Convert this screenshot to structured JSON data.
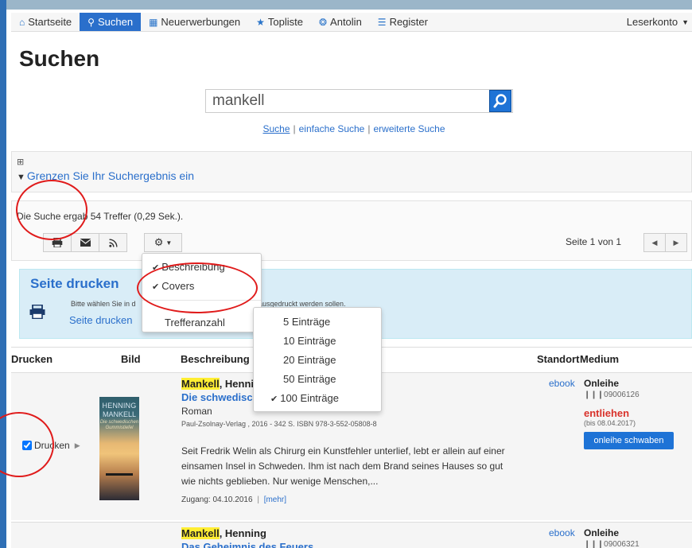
{
  "nav": {
    "items": [
      {
        "label": "Startseite",
        "icon": "home-icon",
        "active": false
      },
      {
        "label": "Suchen",
        "icon": "search-icon",
        "active": true
      },
      {
        "label": "Neuerwerbungen",
        "icon": "calendar-icon",
        "active": false
      },
      {
        "label": "Topliste",
        "icon": "star-icon",
        "active": false
      },
      {
        "label": "Antolin",
        "icon": "globe-icon",
        "active": false
      },
      {
        "label": "Register",
        "icon": "list-icon",
        "active": false
      }
    ],
    "account_label": "Leserkonto"
  },
  "page_title": "Suchen",
  "search": {
    "value": "mankell",
    "links": [
      "Suche",
      "einfache Suche",
      "erweiterte Suche"
    ]
  },
  "filter": {
    "label": "Grenzen Sie Ihr Suchergebnis ein"
  },
  "results": {
    "count_text": "Die Suche ergab 54 Treffer (0,29 Sek.).",
    "page_info": "Seite 1 von 1"
  },
  "print_panel": {
    "title": "Seite drucken",
    "hint_left": "Bitte wählen Sie in d",
    "hint_right": "ausgedruckt werden sollen.",
    "link": "Seite drucken"
  },
  "options_menu": {
    "items": [
      {
        "label": "Beschreibung",
        "checked": true
      },
      {
        "label": "Covers",
        "checked": true
      },
      {
        "label": "Trefferanzahl",
        "checked": false
      }
    ]
  },
  "count_menu": {
    "items": [
      {
        "label": "5 Einträge",
        "checked": false
      },
      {
        "label": "10 Einträge",
        "checked": false
      },
      {
        "label": "20 Einträge",
        "checked": false
      },
      {
        "label": "50 Einträge",
        "checked": false
      },
      {
        "label": "100 Einträge",
        "checked": true
      }
    ]
  },
  "table": {
    "headers": [
      "Drucken",
      "Bild",
      "Beschreibung",
      "Standort",
      "Medium"
    ]
  },
  "rows": [
    {
      "print_label": "Drucken",
      "cover": {
        "line1": "HENNING",
        "line2": "MANKELL",
        "line3": "Die schwedischen Gummistiefel"
      },
      "author_hl": "Mankell",
      "author_rest": ", Henning",
      "title": "Die schwedisch",
      "subtitle": "Roman",
      "publisher": "Paul-Zsolnay-Verlag , 2016 - 342 S. ISBN 978-3-552-05808-8",
      "description": "Seit Fredrik Welin als Chirurg ein Kunstfehler unterlief, lebt er allein auf einer einsamen Insel in Schweden. Ihm ist nach dem Brand seines Hauses so gut wie nichts geblieben. Nur wenige Menschen,...",
      "access": "Zugang: 04.10.2016",
      "more": "[mehr]",
      "location": "ebook",
      "medium": "Onleihe",
      "barcode": "09006126",
      "status": "entliehen",
      "due": "(bis 08.04.2017)",
      "button": "onleihe schwaben"
    },
    {
      "author_hl": "Mankell",
      "author_rest": ", Henning",
      "title": "Das Geheimnis des Feuers",
      "location": "ebook",
      "medium": "Onleihe",
      "barcode": "09006321"
    }
  ],
  "colors": {
    "accent": "#2a6fcb",
    "info_panel": "#d9edf7",
    "highlight": "#ffee33",
    "status_lent": "#d9322b",
    "annotation": "#e01b1b"
  }
}
